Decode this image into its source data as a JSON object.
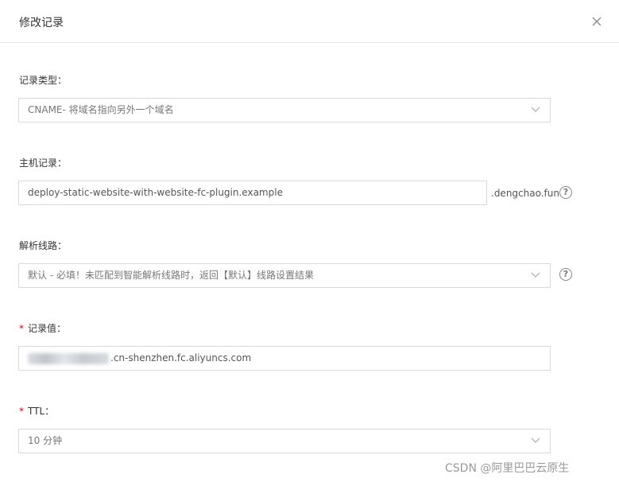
{
  "dialog": {
    "title": "修改记录",
    "close_icon": "close-icon"
  },
  "form": {
    "record_type": {
      "label": "记录类型：",
      "value": "CNAME- 将域名指向另外一个域名"
    },
    "host_record": {
      "label": "主机记录：",
      "value": "deploy-static-website-with-website-fc-plugin.example",
      "suffix": ".dengchao.fun",
      "help_icon": "help-circle-icon"
    },
    "resolve_line": {
      "label": "解析线路：",
      "value": "默认 - 必填！未匹配到智能解析线路时，返回【默认】线路设置结果",
      "help_icon": "help-circle-icon"
    },
    "record_value": {
      "required_mark": "*",
      "label": "记录值：",
      "value": ".cn-shenzhen.fc.aliyuncs.com"
    },
    "ttl": {
      "required_mark": "*",
      "label": "TTL：",
      "value": "10 分钟"
    }
  },
  "watermark": "CSDN @阿里巴巴云原生",
  "colors": {
    "border": "#d9d9d9",
    "required": "#d0021b",
    "text": "#333333"
  }
}
